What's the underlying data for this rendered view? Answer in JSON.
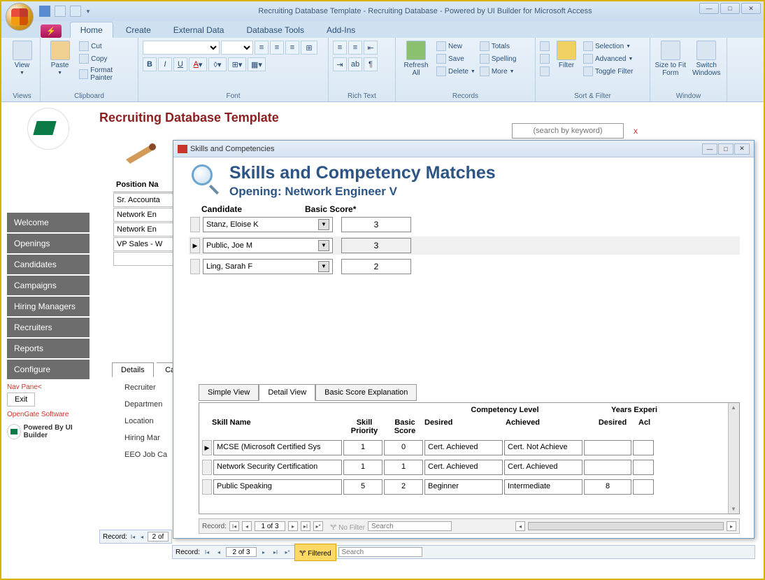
{
  "window": {
    "title": "Recruiting Database Template - Recruiting Database - Powered by UI Builder for Microsoft Access"
  },
  "ribbon": {
    "tabs": [
      "Home",
      "Create",
      "External Data",
      "Database Tools",
      "Add-Ins"
    ],
    "active_tab": "Home",
    "groups": {
      "views": {
        "label": "Views",
        "view": "View"
      },
      "clipboard": {
        "label": "Clipboard",
        "paste": "Paste",
        "cut": "Cut",
        "copy": "Copy",
        "fmt": "Format Painter"
      },
      "font": {
        "label": "Font"
      },
      "richtext": {
        "label": "Rich Text"
      },
      "records": {
        "label": "Records",
        "refresh": "Refresh All",
        "new": "New",
        "save": "Save",
        "delete": "Delete",
        "totals": "Totals",
        "spelling": "Spelling",
        "more": "More"
      },
      "sortfilter": {
        "label": "Sort & Filter",
        "filter": "Filter",
        "selection": "Selection",
        "advanced": "Advanced",
        "toggle": "Toggle Filter"
      },
      "window": {
        "label": "Window",
        "size": "Size to Fit Form",
        "switch": "Switch Windows"
      }
    }
  },
  "nav": {
    "items": [
      "Welcome",
      "Openings",
      "Candidates",
      "Campaigns",
      "Hiring Managers",
      "Recruiters",
      "Reports",
      "Configure"
    ],
    "navpane": "Nav Pane<",
    "exit": "Exit",
    "copyright": "OpenGate Software",
    "powered": "Powered By UI Builder"
  },
  "page": {
    "title": "Recruiting Database Template",
    "search_placeholder": "(search by keyword)"
  },
  "positions": {
    "header": "Position Na",
    "rows": [
      "Sr. Accounta",
      "Network En",
      "Network En",
      "VP Sales - W"
    ]
  },
  "details": {
    "tab_label": "Details",
    "tab2": "Ca",
    "fields": [
      "Recruiter",
      "Departmen",
      "Location",
      "Hiring Mar",
      "EEO Job Ca"
    ]
  },
  "dialog": {
    "title": "Skills and Competencies",
    "h1": "Skills and Competency Matches",
    "h2_label": "Opening:",
    "h2_value": "Network Engineer V",
    "cand_header": "Candidate",
    "score_header": "Basic Score*",
    "candidates": [
      {
        "name": "Stanz, Eloise K",
        "score": "3"
      },
      {
        "name": "Public, Joe M",
        "score": "3"
      },
      {
        "name": "Ling, Sarah F",
        "score": "2"
      }
    ],
    "subtabs": [
      "Simple View",
      "Detail View",
      "Basic Score Explanation"
    ],
    "skills": {
      "superheaders": {
        "comp": "Competency Level",
        "yrs": "Years Experi"
      },
      "headers": {
        "name": "Skill Name",
        "priority": "Skill Priority",
        "score": "Basic Score",
        "desired": "Desired",
        "achieved": "Achieved",
        "ydesired": "Desired",
        "yachieved": "Acl"
      },
      "rows": [
        {
          "name": "MCSE (Microsoft Certified Sys",
          "priority": "1",
          "score": "0",
          "desired": "Cert. Achieved",
          "achieved": "Cert. Not Achieve",
          "yd": "",
          "ya": ""
        },
        {
          "name": "Network Security Certification",
          "priority": "1",
          "score": "1",
          "desired": "Cert. Achieved",
          "achieved": "Cert. Achieved",
          "yd": "",
          "ya": ""
        },
        {
          "name": "Public Speaking",
          "priority": "5",
          "score": "2",
          "desired": "Beginner",
          "achieved": "Intermediate",
          "yd": "8",
          "ya": ""
        }
      ]
    },
    "recnav": {
      "label": "Record:",
      "pos": "1 of 3",
      "nofilter": "No Filter",
      "search": "Search"
    }
  },
  "outer_recnav1": {
    "label": "Record:",
    "pos": "2 of"
  },
  "outer_recnav2": {
    "label": "Record:",
    "pos": "2 of 3",
    "filtered": "Filtered",
    "search": "Search"
  }
}
